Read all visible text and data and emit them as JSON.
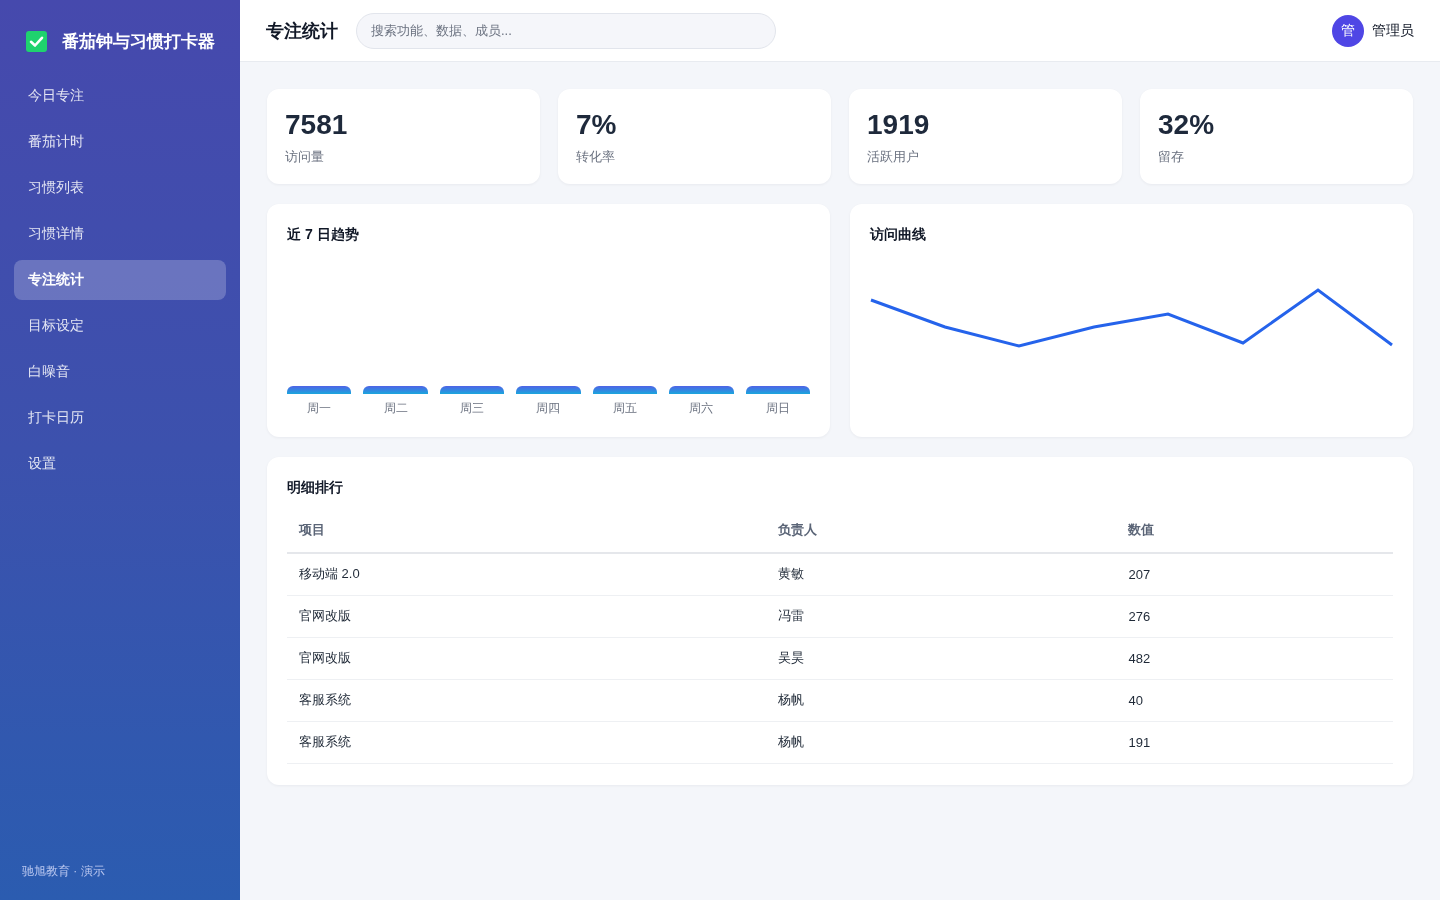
{
  "sidebar": {
    "logo": {
      "title": "番茄钟与习惯打卡器"
    },
    "items": [
      {
        "label": "今日专注",
        "selected": false
      },
      {
        "label": "番茄计时",
        "selected": false
      },
      {
        "label": "习惯列表",
        "selected": false
      },
      {
        "label": "习惯详情",
        "selected": false
      },
      {
        "label": "专注统计",
        "selected": true
      },
      {
        "label": "目标设定",
        "selected": false
      },
      {
        "label": "白噪音",
        "selected": false
      },
      {
        "label": "打卡日历",
        "selected": false
      },
      {
        "label": "设置",
        "selected": false
      }
    ],
    "footer": "驰旭教育 · 演示"
  },
  "header": {
    "title": "专注统计",
    "search": {
      "placeholder": "搜索功能、数据、成员..."
    },
    "user": {
      "avatar": "管",
      "name": "管理员"
    }
  },
  "stats": [
    {
      "value": "7581",
      "label": "访问量"
    },
    {
      "value": "7%",
      "label": "转化率"
    },
    {
      "value": "1919",
      "label": "活跃用户"
    },
    {
      "value": "32%",
      "label": "留存"
    }
  ],
  "trend_chart": {
    "title": "近 7 日趋势",
    "days": [
      "周一",
      "周二",
      "周三",
      "周四",
      "周五",
      "周六",
      "周日"
    ]
  },
  "visits_chart": {
    "title": "访问曲线"
  },
  "table": {
    "title": "明细排行",
    "columns": [
      "项目",
      "负责人",
      "数值"
    ],
    "rows": [
      [
        "移动端 2.0",
        "黄敏",
        "207"
      ],
      [
        "官网改版",
        "冯雷",
        "276"
      ],
      [
        "官网改版",
        "吴昊",
        "482"
      ],
      [
        "客服系统",
        "杨帆",
        "40"
      ],
      [
        "客服系统",
        "杨帆",
        "191"
      ]
    ]
  }
}
